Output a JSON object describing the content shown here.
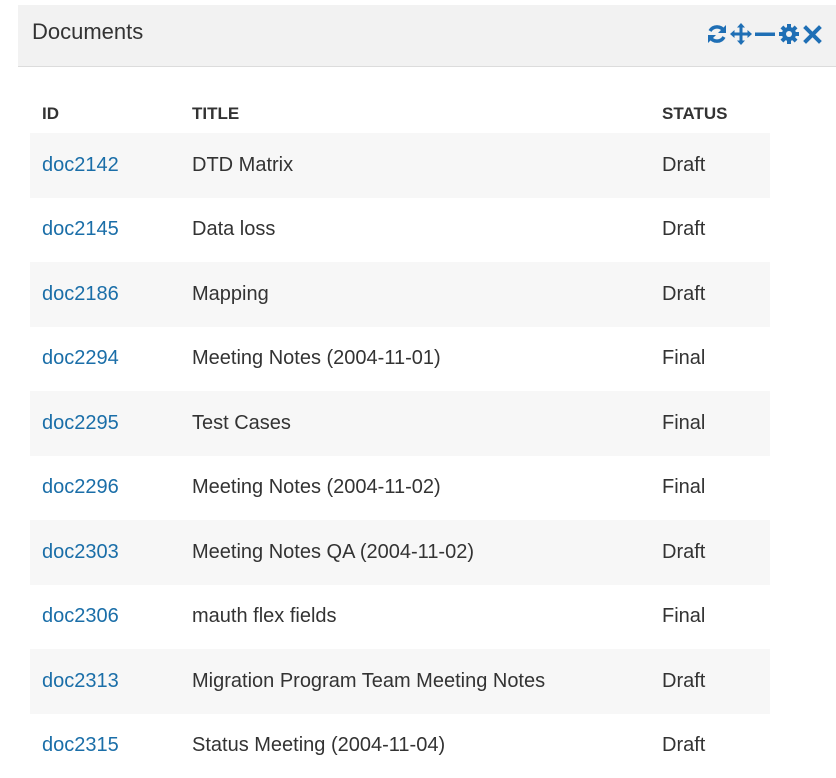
{
  "widget": {
    "title": "Documents",
    "accent_color": "#1f6fb5",
    "tools": [
      {
        "icon": "refresh-icon"
      },
      {
        "icon": "move-icon"
      },
      {
        "icon": "minimize-icon"
      },
      {
        "icon": "gear-icon"
      },
      {
        "icon": "close-icon"
      }
    ]
  },
  "table": {
    "columns": [
      "ID",
      "TITLE",
      "STATUS"
    ],
    "rows": [
      {
        "id": "doc2142",
        "title": "DTD Matrix",
        "status": "Draft"
      },
      {
        "id": "doc2145",
        "title": "Data loss",
        "status": "Draft"
      },
      {
        "id": "doc2186",
        "title": "Mapping",
        "status": "Draft"
      },
      {
        "id": "doc2294",
        "title": "Meeting Notes (2004-11-01)",
        "status": "Final"
      },
      {
        "id": "doc2295",
        "title": "Test Cases",
        "status": "Final"
      },
      {
        "id": "doc2296",
        "title": "Meeting Notes (2004-11-02)",
        "status": "Final"
      },
      {
        "id": "doc2303",
        "title": "Meeting Notes QA (2004-11-02)",
        "status": "Draft"
      },
      {
        "id": "doc2306",
        "title": "mauth flex fields",
        "status": "Final"
      },
      {
        "id": "doc2313",
        "title": "Migration Program Team Meeting Notes",
        "status": "Draft"
      },
      {
        "id": "doc2315",
        "title": "Status Meeting (2004-11-04)",
        "status": "Draft"
      }
    ]
  }
}
